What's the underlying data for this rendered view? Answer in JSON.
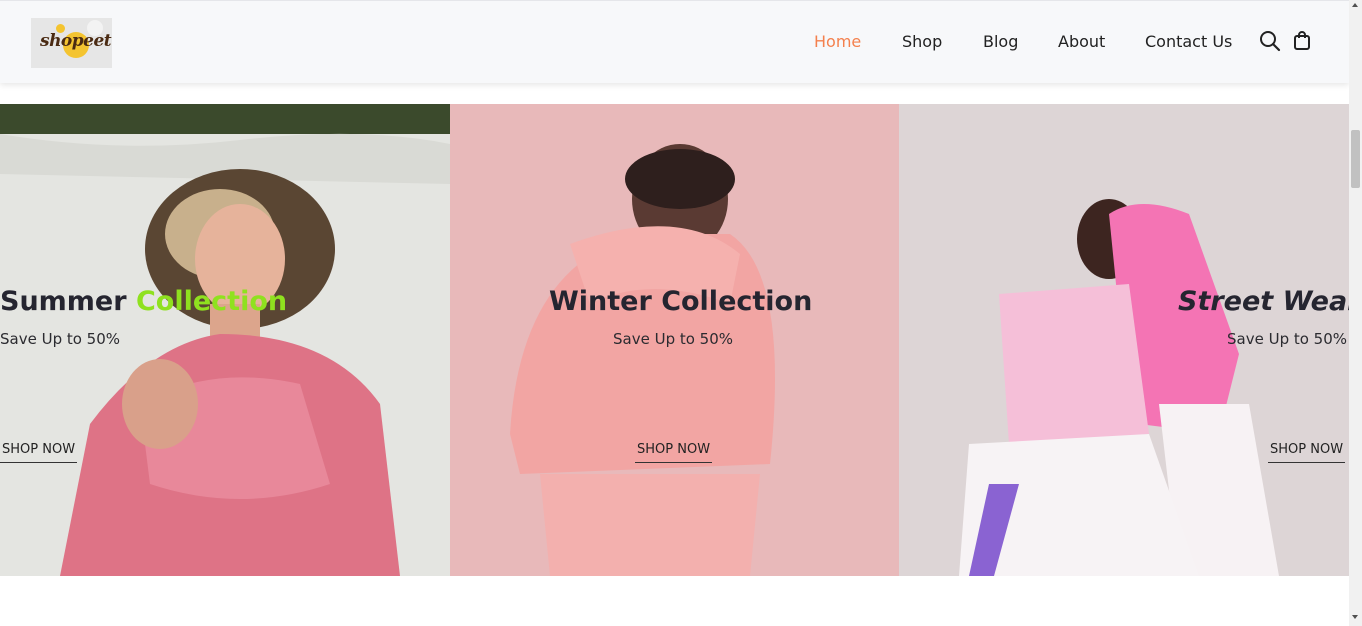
{
  "brand": {
    "logo_text": "shopeet"
  },
  "nav": {
    "items": [
      "Home",
      "Shop",
      "Blog",
      "About",
      "Contact Us"
    ],
    "active": "Home"
  },
  "icons": {
    "search": "search-icon",
    "cart": "shopping-bag-icon"
  },
  "colors": {
    "nav_active": "#f4804d",
    "accent_green": "#8fe11f",
    "header_bg": "#f7f8fa"
  },
  "banners": [
    {
      "title_main": "Summer ",
      "title_accent": "Collection",
      "subtitle": "Save Up to 50%",
      "cta": "SHOP NOW"
    },
    {
      "title_main": "Winter Collection",
      "subtitle": "Save Up to 50%",
      "cta": "SHOP NOW"
    },
    {
      "title_main": "Street Wear",
      "subtitle": "Save Up to 50%",
      "cta": "SHOP NOW"
    }
  ]
}
